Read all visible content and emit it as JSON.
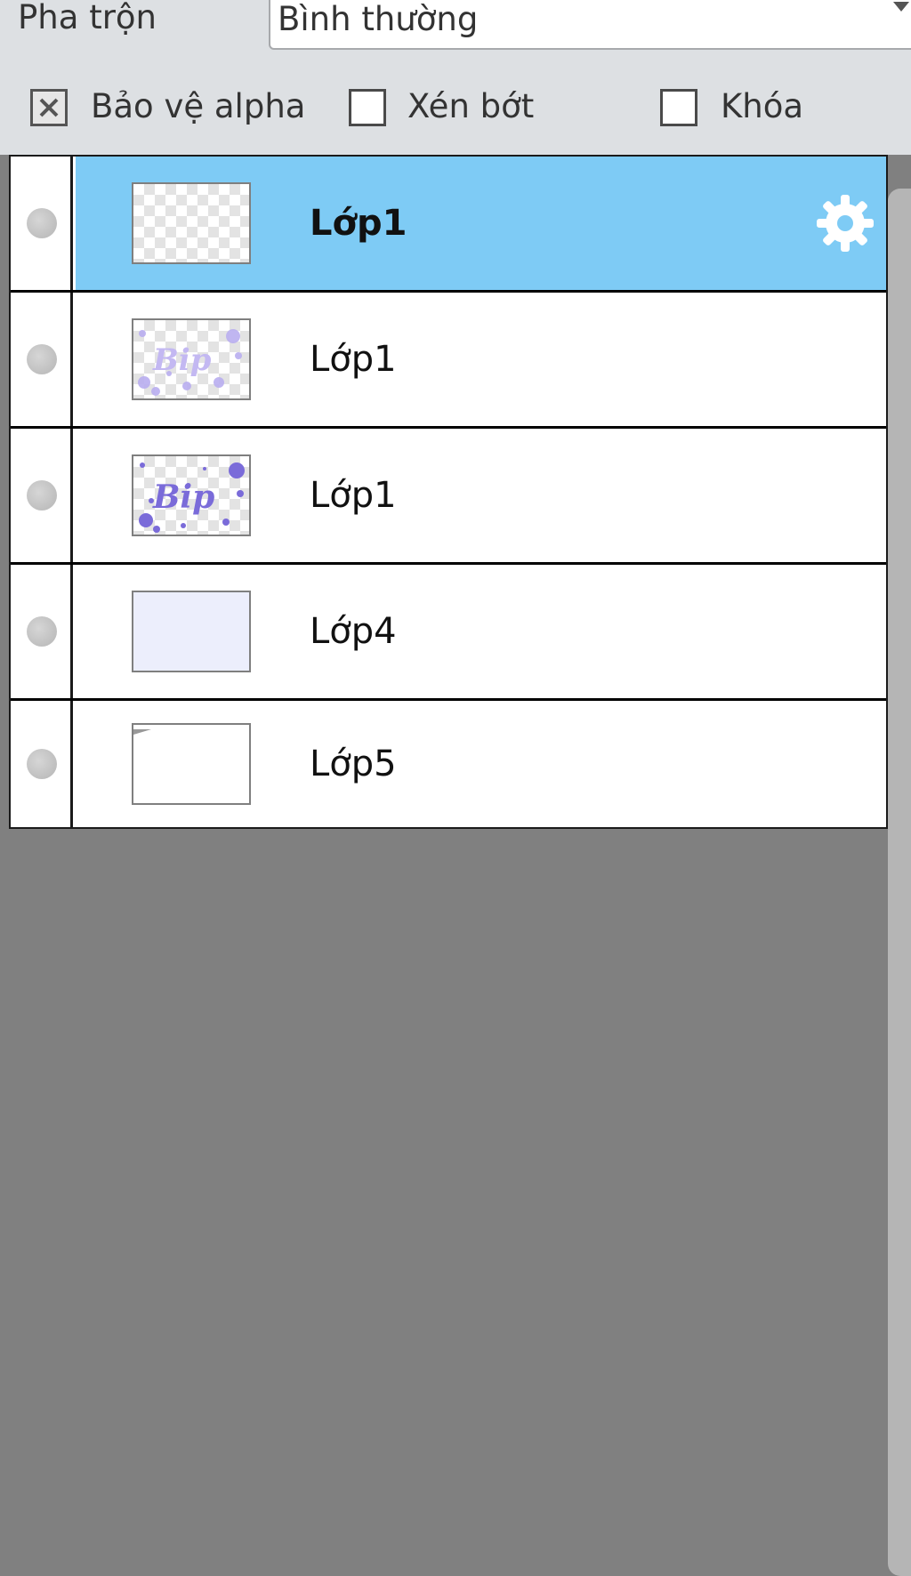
{
  "blend": {
    "label": "Pha trộn",
    "value": "Bình thường"
  },
  "options": [
    {
      "label": "Bảo vệ alpha",
      "checked": true
    },
    {
      "label": "Xén bớt",
      "checked": false
    },
    {
      "label": "Khóa",
      "checked": false
    }
  ],
  "layers": [
    {
      "name": "Lớp1",
      "selected": true,
      "thumb": "empty-transparent"
    },
    {
      "name": "Lớp1",
      "selected": false,
      "thumb": "bip-text-light"
    },
    {
      "name": "Lớp1",
      "selected": false,
      "thumb": "bip-text-dark"
    },
    {
      "name": "Lớp4",
      "selected": false,
      "thumb": "pale-lavender-fill"
    },
    {
      "name": "Lớp5",
      "selected": false,
      "thumb": "white"
    }
  ],
  "colors": {
    "selected_row": "#7ecbf5",
    "panel_bg": "#808080",
    "toolbar_bg": "#dde0e3",
    "thumb_purple": "#7a6bd9"
  },
  "icons": {
    "layer_settings": "gear-icon",
    "visibility": "visibility-dot-icon",
    "dropdown": "chevron-down-icon"
  }
}
